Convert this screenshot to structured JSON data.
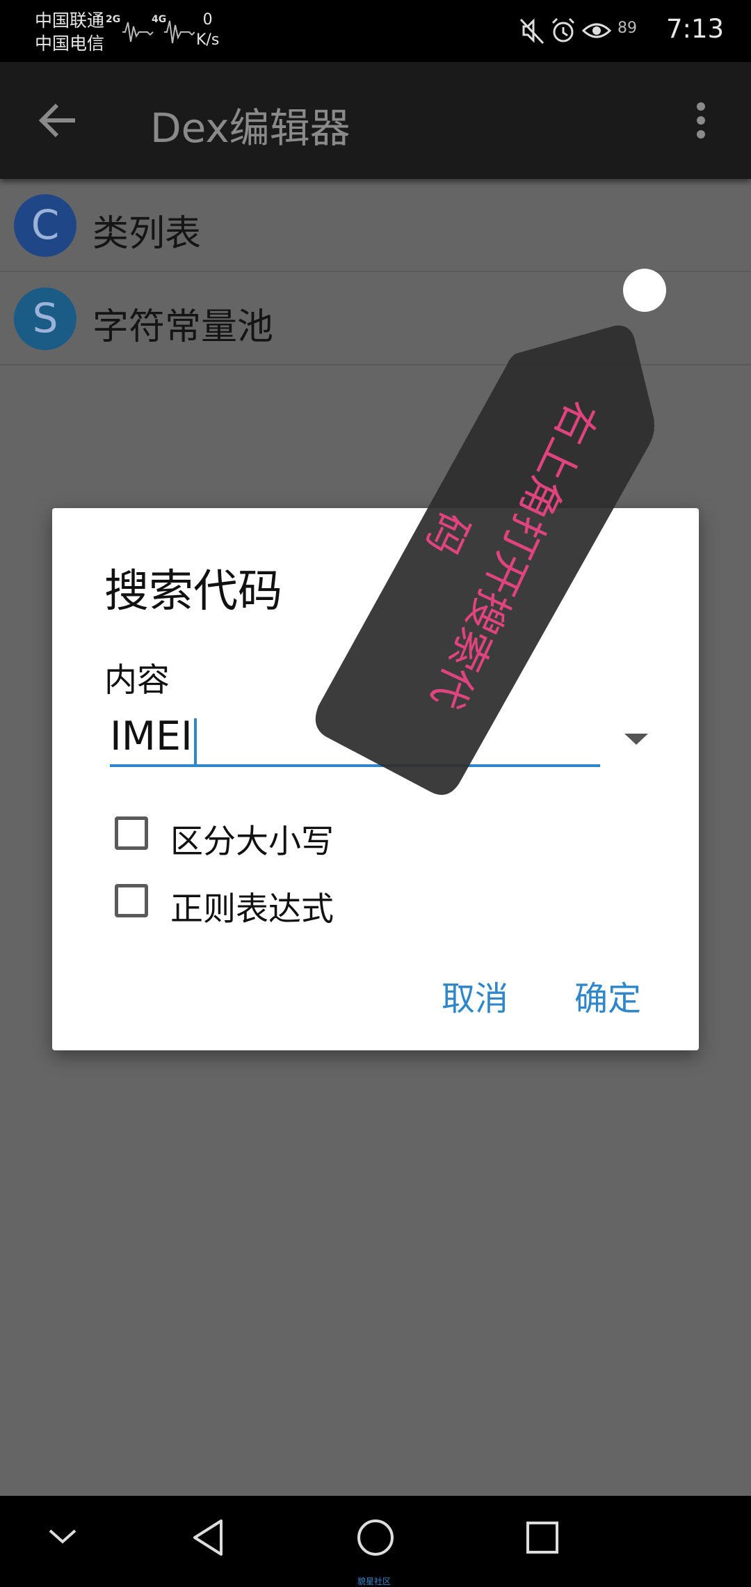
{
  "status_bar": {
    "carrier1": "中国联通",
    "carrier2": "中国电信",
    "net1": "2G",
    "net2": "4G",
    "speed_value": "0",
    "speed_unit": "K/s",
    "battery": "89",
    "time": "7:13",
    "icons": [
      "mute-icon",
      "alarm-icon",
      "eye-comfort-icon"
    ]
  },
  "app_bar": {
    "title": "Dex编辑器",
    "back_icon": "arrow-left-icon",
    "menu_icon": "more-vert-icon"
  },
  "list": {
    "items": [
      {
        "letter": "C",
        "label": "类列表",
        "color": "#1f4687"
      },
      {
        "letter": "S",
        "label": "字符常量池",
        "color": "#1b5c87"
      }
    ]
  },
  "dialog": {
    "title": "搜索代码",
    "field_label": "内容",
    "input_value": "IMEI",
    "checkboxes": [
      {
        "label": "区分大小写",
        "checked": false
      },
      {
        "label": "正则表达式",
        "checked": false
      }
    ],
    "cancel": "取消",
    "confirm": "确定"
  },
  "tooltip_tag": {
    "line1": "右上角打开搜索代",
    "line2": "码",
    "text_color": "#e0447e"
  },
  "nav_bar": {
    "icons": [
      "collapse-icon",
      "back-triangle-icon",
      "home-circle-icon",
      "recents-square-icon"
    ],
    "caption": "貌星社区"
  },
  "colors": {
    "accent": "#2f86c8",
    "scrim": "#656565",
    "app_bar": "#1a1a1a"
  }
}
